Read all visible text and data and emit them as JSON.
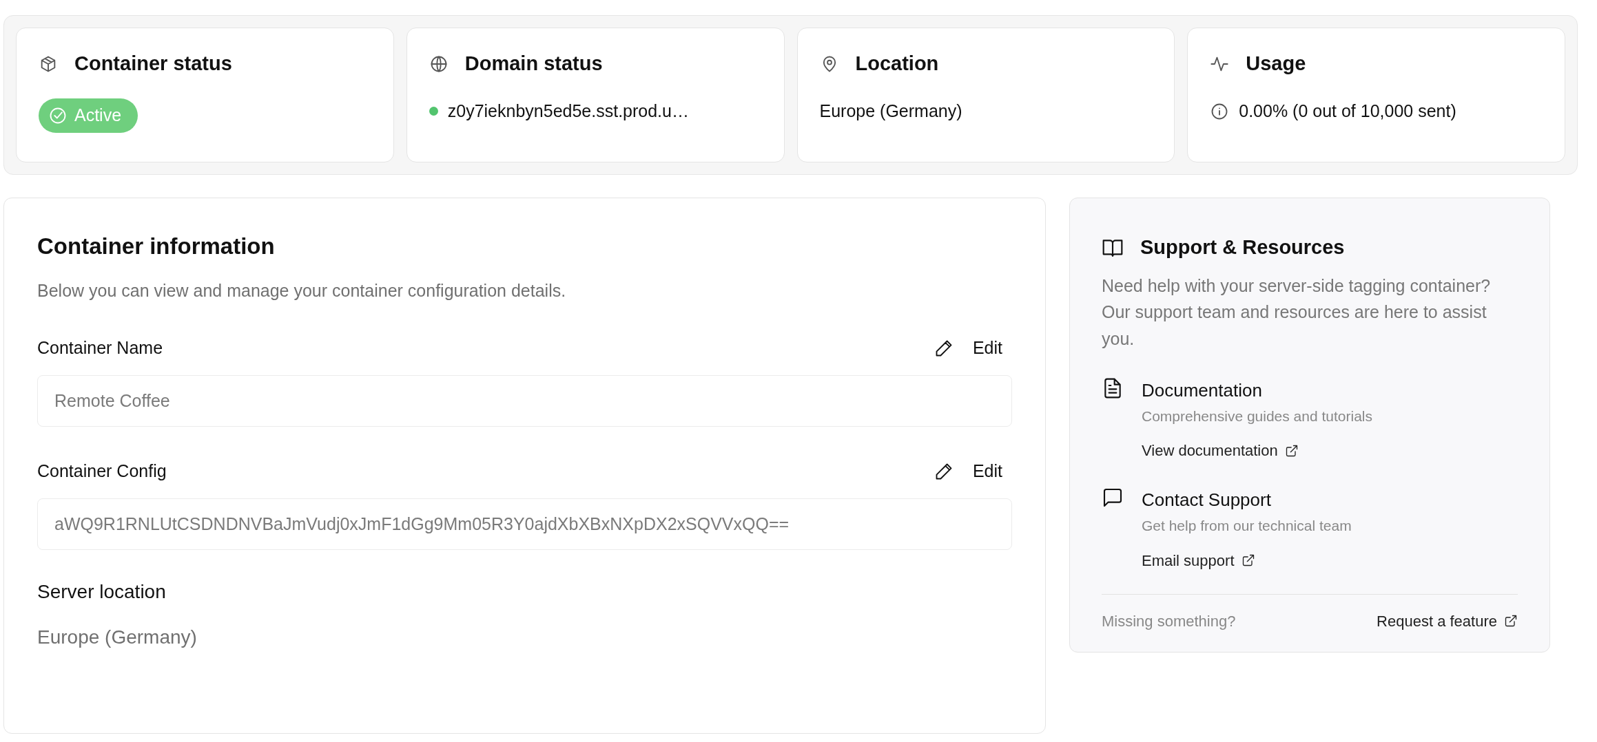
{
  "status_cards": [
    {
      "kind": "status",
      "title": "Container status",
      "badge": "Active"
    },
    {
      "kind": "domain",
      "title": "Domain status",
      "value": "z0y7ieknbyn5ed5e.sst.prod.u…",
      "color": "#52c46e"
    },
    {
      "kind": "location",
      "title": "Location",
      "value": "Europe (Germany)"
    },
    {
      "kind": "usage",
      "title": "Usage",
      "value": "0.00% (0 out of 10,000 sent)"
    }
  ],
  "container_info": {
    "title": "Container information",
    "description": "Below you can view and manage your container configuration details.",
    "fields": [
      {
        "label": "Container Name",
        "action": "Edit",
        "value": "Remote Coffee"
      },
      {
        "label": "Container Config",
        "action": "Edit",
        "value": "aWQ9R1RNLUtCSDNDNVBaJmVudj0xJmF1dGg9Mm05R3Y0ajdXbXBxNXpDX2xSQVVxQQ=="
      }
    ],
    "server_location": {
      "label": "Server location",
      "value": "Europe (Germany)"
    }
  },
  "support": {
    "title": "Support & Resources",
    "description": "Need help with your server-side tagging container? Our support team and resources are here to assist you.",
    "items": [
      {
        "kind": "docs",
        "title": "Documentation",
        "subtitle": "Comprehensive guides and tutorials",
        "link": "View documentation"
      },
      {
        "kind": "contact",
        "title": "Contact Support",
        "subtitle": "Get help from our technical team",
        "link": "Email support"
      }
    ],
    "footer": {
      "note": "Missing something?",
      "link": "Request a feature"
    }
  }
}
